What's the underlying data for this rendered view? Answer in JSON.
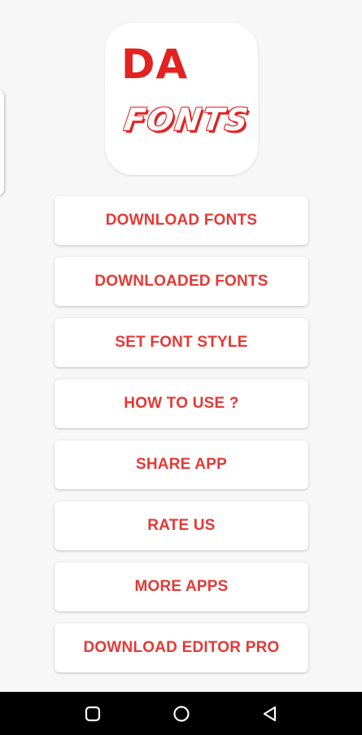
{
  "logo": {
    "line1": "DA",
    "line2": "FONTS"
  },
  "menu": {
    "items": [
      {
        "label": "DOWNLOAD FONTS"
      },
      {
        "label": "DOWNLOADED FONTS"
      },
      {
        "label": "SET FONT STYLE"
      },
      {
        "label": "HOW TO USE ?"
      },
      {
        "label": "SHARE APP"
      },
      {
        "label": "RATE US"
      },
      {
        "label": "MORE APPS"
      },
      {
        "label": "DOWNLOAD EDITOR PRO"
      }
    ]
  },
  "navigation_bar": {
    "icons": [
      "recents-icon",
      "home-icon",
      "back-icon"
    ]
  },
  "colors": {
    "accent": "#e53935",
    "background": "#f7f7f7",
    "button_background": "#ffffff",
    "nav_bar": "#000000"
  }
}
